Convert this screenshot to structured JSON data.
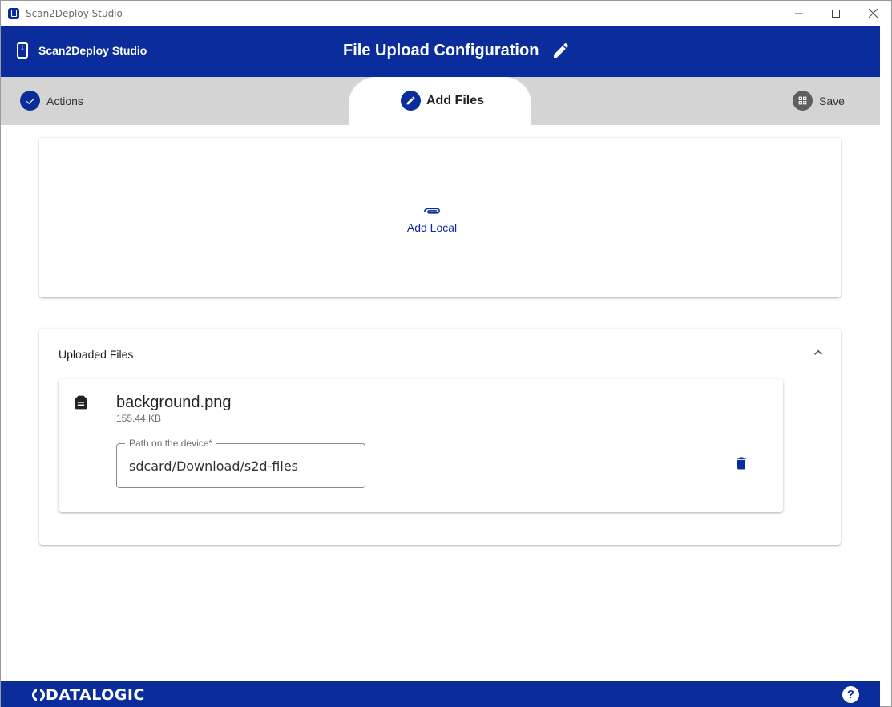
{
  "window": {
    "title": "Scan2Deploy Studio",
    "controls": {
      "minimize": "—",
      "maximize": "☐",
      "close": "✕"
    }
  },
  "header": {
    "brand": "Scan2Deploy Studio",
    "page_title": "File Upload Configuration",
    "brand_color": "#0b2d9c"
  },
  "stepper": {
    "steps": [
      {
        "label": "Actions",
        "icon": "check-icon",
        "state": "done"
      },
      {
        "label": "Add Files",
        "icon": "pencil-icon",
        "state": "active"
      },
      {
        "label": "Save",
        "icon": "qr-code-icon",
        "state": "pending"
      }
    ]
  },
  "add_files": {
    "add_local_label": "Add Local",
    "add_local_icon": "paperclip-icon"
  },
  "uploaded": {
    "title": "Uploaded Files",
    "files": [
      {
        "name": "background.png",
        "size": "155.44 KB",
        "path_label": "Path on the device*",
        "path_value": "sdcard/Download/s2d-files"
      }
    ]
  },
  "footer": {
    "logo_text": "DATALOGIC",
    "help": "?"
  }
}
